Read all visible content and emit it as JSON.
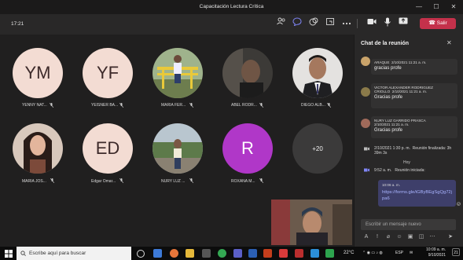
{
  "window": {
    "title": "Capacitación Lectura Crítica",
    "minimize": "—",
    "maximize": "☐",
    "close": "✕"
  },
  "meeting_toolbar": {
    "elapsed": "17:21",
    "hangup_label": "Salir",
    "hangup_color": "#c4314b"
  },
  "participants": [
    {
      "initials": "YM",
      "name": "YENNY NAT...",
      "bg": "#f3dcd3",
      "photo": false
    },
    {
      "initials": "YF",
      "name": "YEISNER BA...",
      "bg": "#f3dcd3",
      "photo": false
    },
    {
      "initials": "",
      "name": "MARIA FER...",
      "bg": "#8a9a6a",
      "photo": true
    },
    {
      "initials": "",
      "name": "ABEL RODR...",
      "bg": "#4a4744",
      "photo": true
    },
    {
      "initials": "",
      "name": "DIEGO ALB...",
      "bg": "#d9d5d2",
      "photo": true
    },
    {
      "initials": "",
      "name": "MARIA JOS...",
      "bg": "#8c6c5c",
      "photo": true
    },
    {
      "initials": "ED",
      "name": "Edgar Omar...",
      "bg": "#f3dcd3",
      "photo": false
    },
    {
      "initials": "",
      "name": "NURY LUZ ...",
      "bg": "#7a8c6a",
      "photo": true
    },
    {
      "initials": "R",
      "name": "ROXANA M...",
      "bg": "#b037c8",
      "photo": false
    },
    {
      "initials": "+20",
      "name": "",
      "bg": "#3b3a3a",
      "photo": false
    }
  ],
  "chat": {
    "title": "Chat de la reunión",
    "messages": [
      {
        "author": "ARAQUE",
        "time": "2/10/2021 11:21 a. m.",
        "text": "gracias profe"
      },
      {
        "author": "VICTOR ALEXANDER RODRIGUEZ CRIOLLO",
        "time": "2/10/2021 11:21 a. m.",
        "text": "Gracias profe"
      },
      {
        "author": "NURY LUZ GARRIDO PRASCA",
        "time": "2/10/2021 11:21 a. m.",
        "text": "Gracias profe"
      }
    ],
    "meeting_end": {
      "time": "2/10/2021 1:30 p. m.",
      "text": "Reunión finalizada: 3h 39m 3s"
    },
    "today_label": "Hoy",
    "meeting_start": {
      "time": "9:52 a. m.",
      "text": "Reunión iniciada:"
    },
    "own_message": {
      "time": "10:06 a. m.",
      "link": "https://forms.gle/iGByBEgSgQg72jpa6"
    },
    "composer_placeholder": "Escribir un mensaje nuevo"
  },
  "taskbar": {
    "search_placeholder": "Escribe aquí para buscar",
    "weather": "22°C",
    "lang": "ESP",
    "time": "10:09 a. m.",
    "date": "9/10/2021",
    "notifications": "21"
  }
}
